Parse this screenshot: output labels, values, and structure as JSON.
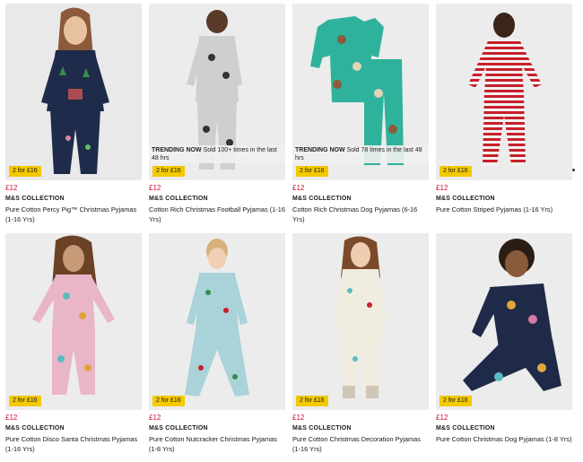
{
  "products": [
    {
      "badge": "2 for £16",
      "price": "£12",
      "brand": "M&S COLLECTION",
      "title": "Pure Cotton Percy Pig™ Christmas Pyjamas (1-16 Yrs)",
      "trending": null,
      "image": "girl-navy-christmas-pyjamas"
    },
    {
      "badge": "2 for £16",
      "price": "£12",
      "brand": "M&S COLLECTION",
      "title": "Cotton Rich Christmas Football Pyjamas (1-16 Yrs)",
      "trending": {
        "tag": "TRENDING NOW",
        "text": "Sold 100+ times in the last 48 hrs"
      },
      "image": "boy-grey-football-pyjamas"
    },
    {
      "badge": "2 for £16",
      "price": "£12",
      "brand": "M&S COLLECTION",
      "title": "Cotton Rich Christmas Dog Pyjamas (6-16 Yrs)",
      "trending": {
        "tag": "TRENDING NOW",
        "text": "Sold 78 times in the last 48 hrs"
      },
      "image": "teal-dog-pyjamas-flatlay"
    },
    {
      "badge": "2 for £16",
      "price": "£12",
      "brand": "M&S COLLECTION",
      "title": "Pure Cotton Striped Pyjamas (1-16 Yrs)",
      "trending": null,
      "image": "girl-red-striped-pyjamas"
    },
    {
      "badge": "2 for £16",
      "price": "£12",
      "brand": "M&S COLLECTION",
      "title": "Pure Cotton Disco Santa Christmas Pyjamas (1-16 Yrs)",
      "trending": null,
      "image": "girl-pink-santa-pyjamas"
    },
    {
      "badge": "2 for £16",
      "price": "£12",
      "brand": "M&S COLLECTION",
      "title": "Pure Cotton Nutcracker Christmas Pyjamas (1-8 Yrs)",
      "trending": null,
      "image": "girl-blue-nutcracker-pyjamas"
    },
    {
      "badge": "2 for £16",
      "price": "£12",
      "brand": "M&S COLLECTION",
      "title": "Pure Cotton Christmas Decoration Pyjamas (1-16 Yrs)",
      "trending": null,
      "image": "girl-cream-decoration-pyjamas"
    },
    {
      "badge": "2 for £16",
      "price": "£12",
      "brand": "M&S COLLECTION",
      "title": "Pure Cotton Christmas Dog Pyjamas (1-8 Yrs)",
      "trending": null,
      "image": "girl-navy-dog-pyjamas"
    }
  ],
  "colors": {
    "badge": "#f4c900",
    "price": "#c8102e",
    "image_bg": "#eeeeee"
  }
}
